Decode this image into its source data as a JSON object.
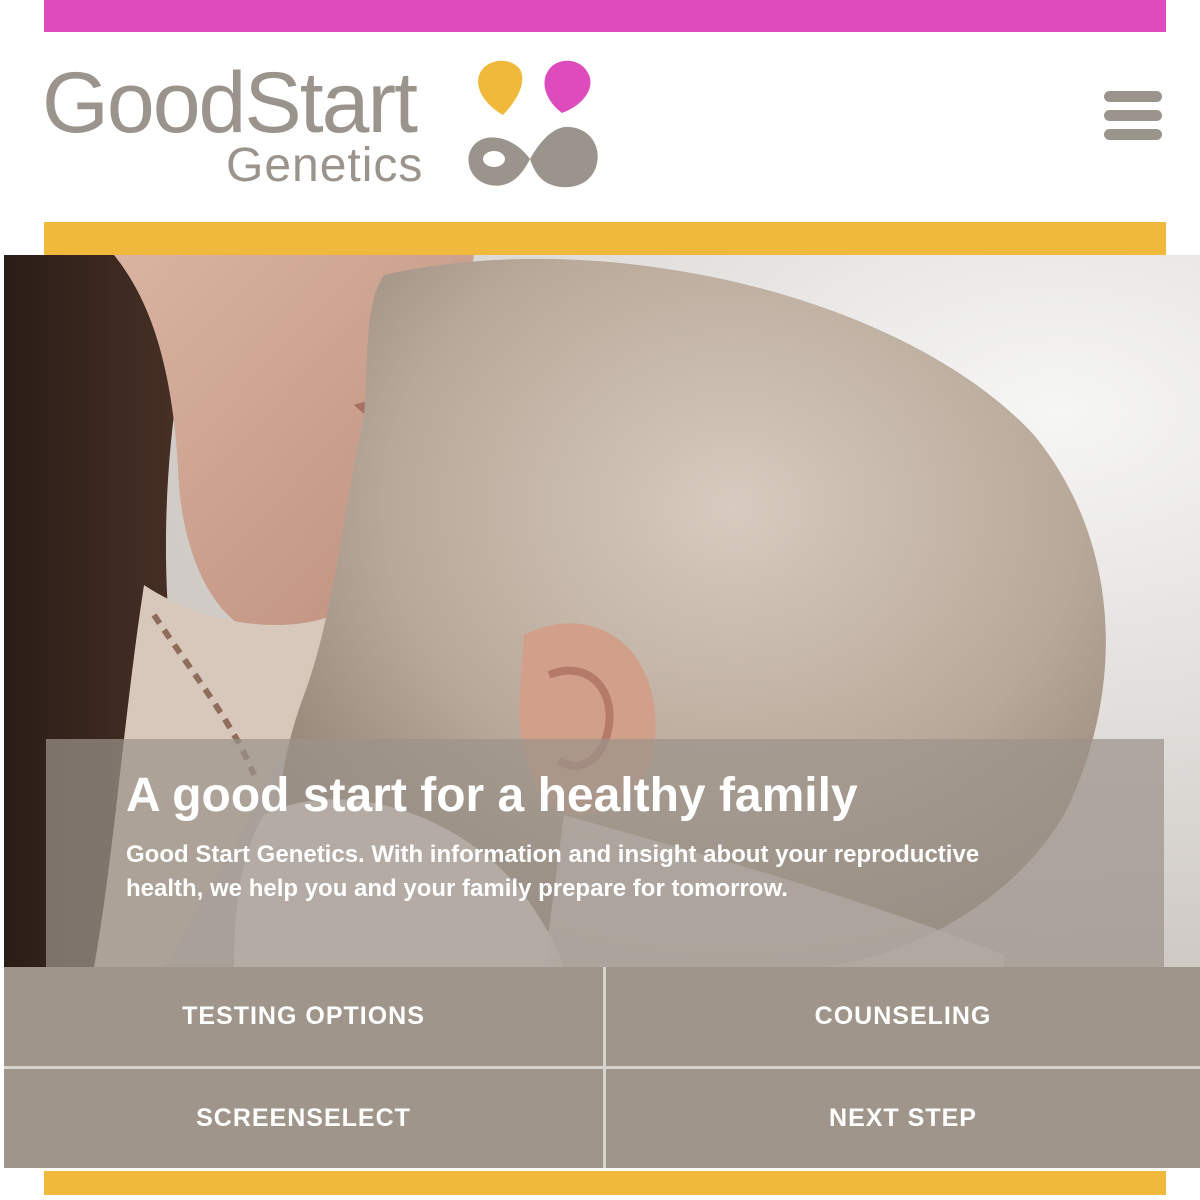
{
  "brand": {
    "name_line1": "GoodStart",
    "name_line2": "Genetics",
    "logo_icon": "ampersand-dots-logo-mark",
    "colors": {
      "magenta": "#dd4bbd",
      "gold": "#f0b93b",
      "taupe": "#9b948d",
      "tile": "#a0958b"
    }
  },
  "header": {
    "menu_icon": "hamburger-menu-icon"
  },
  "hero": {
    "image": "mother-kissing-baby-head-photo",
    "title": "A good start for a healthy family",
    "body": "Good Start Genetics. With information and insight about your reproductive health, we help you and your family prepare for tomorrow."
  },
  "nav": {
    "tiles": [
      {
        "label": "TESTING OPTIONS"
      },
      {
        "label": "COUNSELING"
      },
      {
        "label": "SCREENSELECT"
      },
      {
        "label": "NEXT STEP"
      }
    ]
  }
}
